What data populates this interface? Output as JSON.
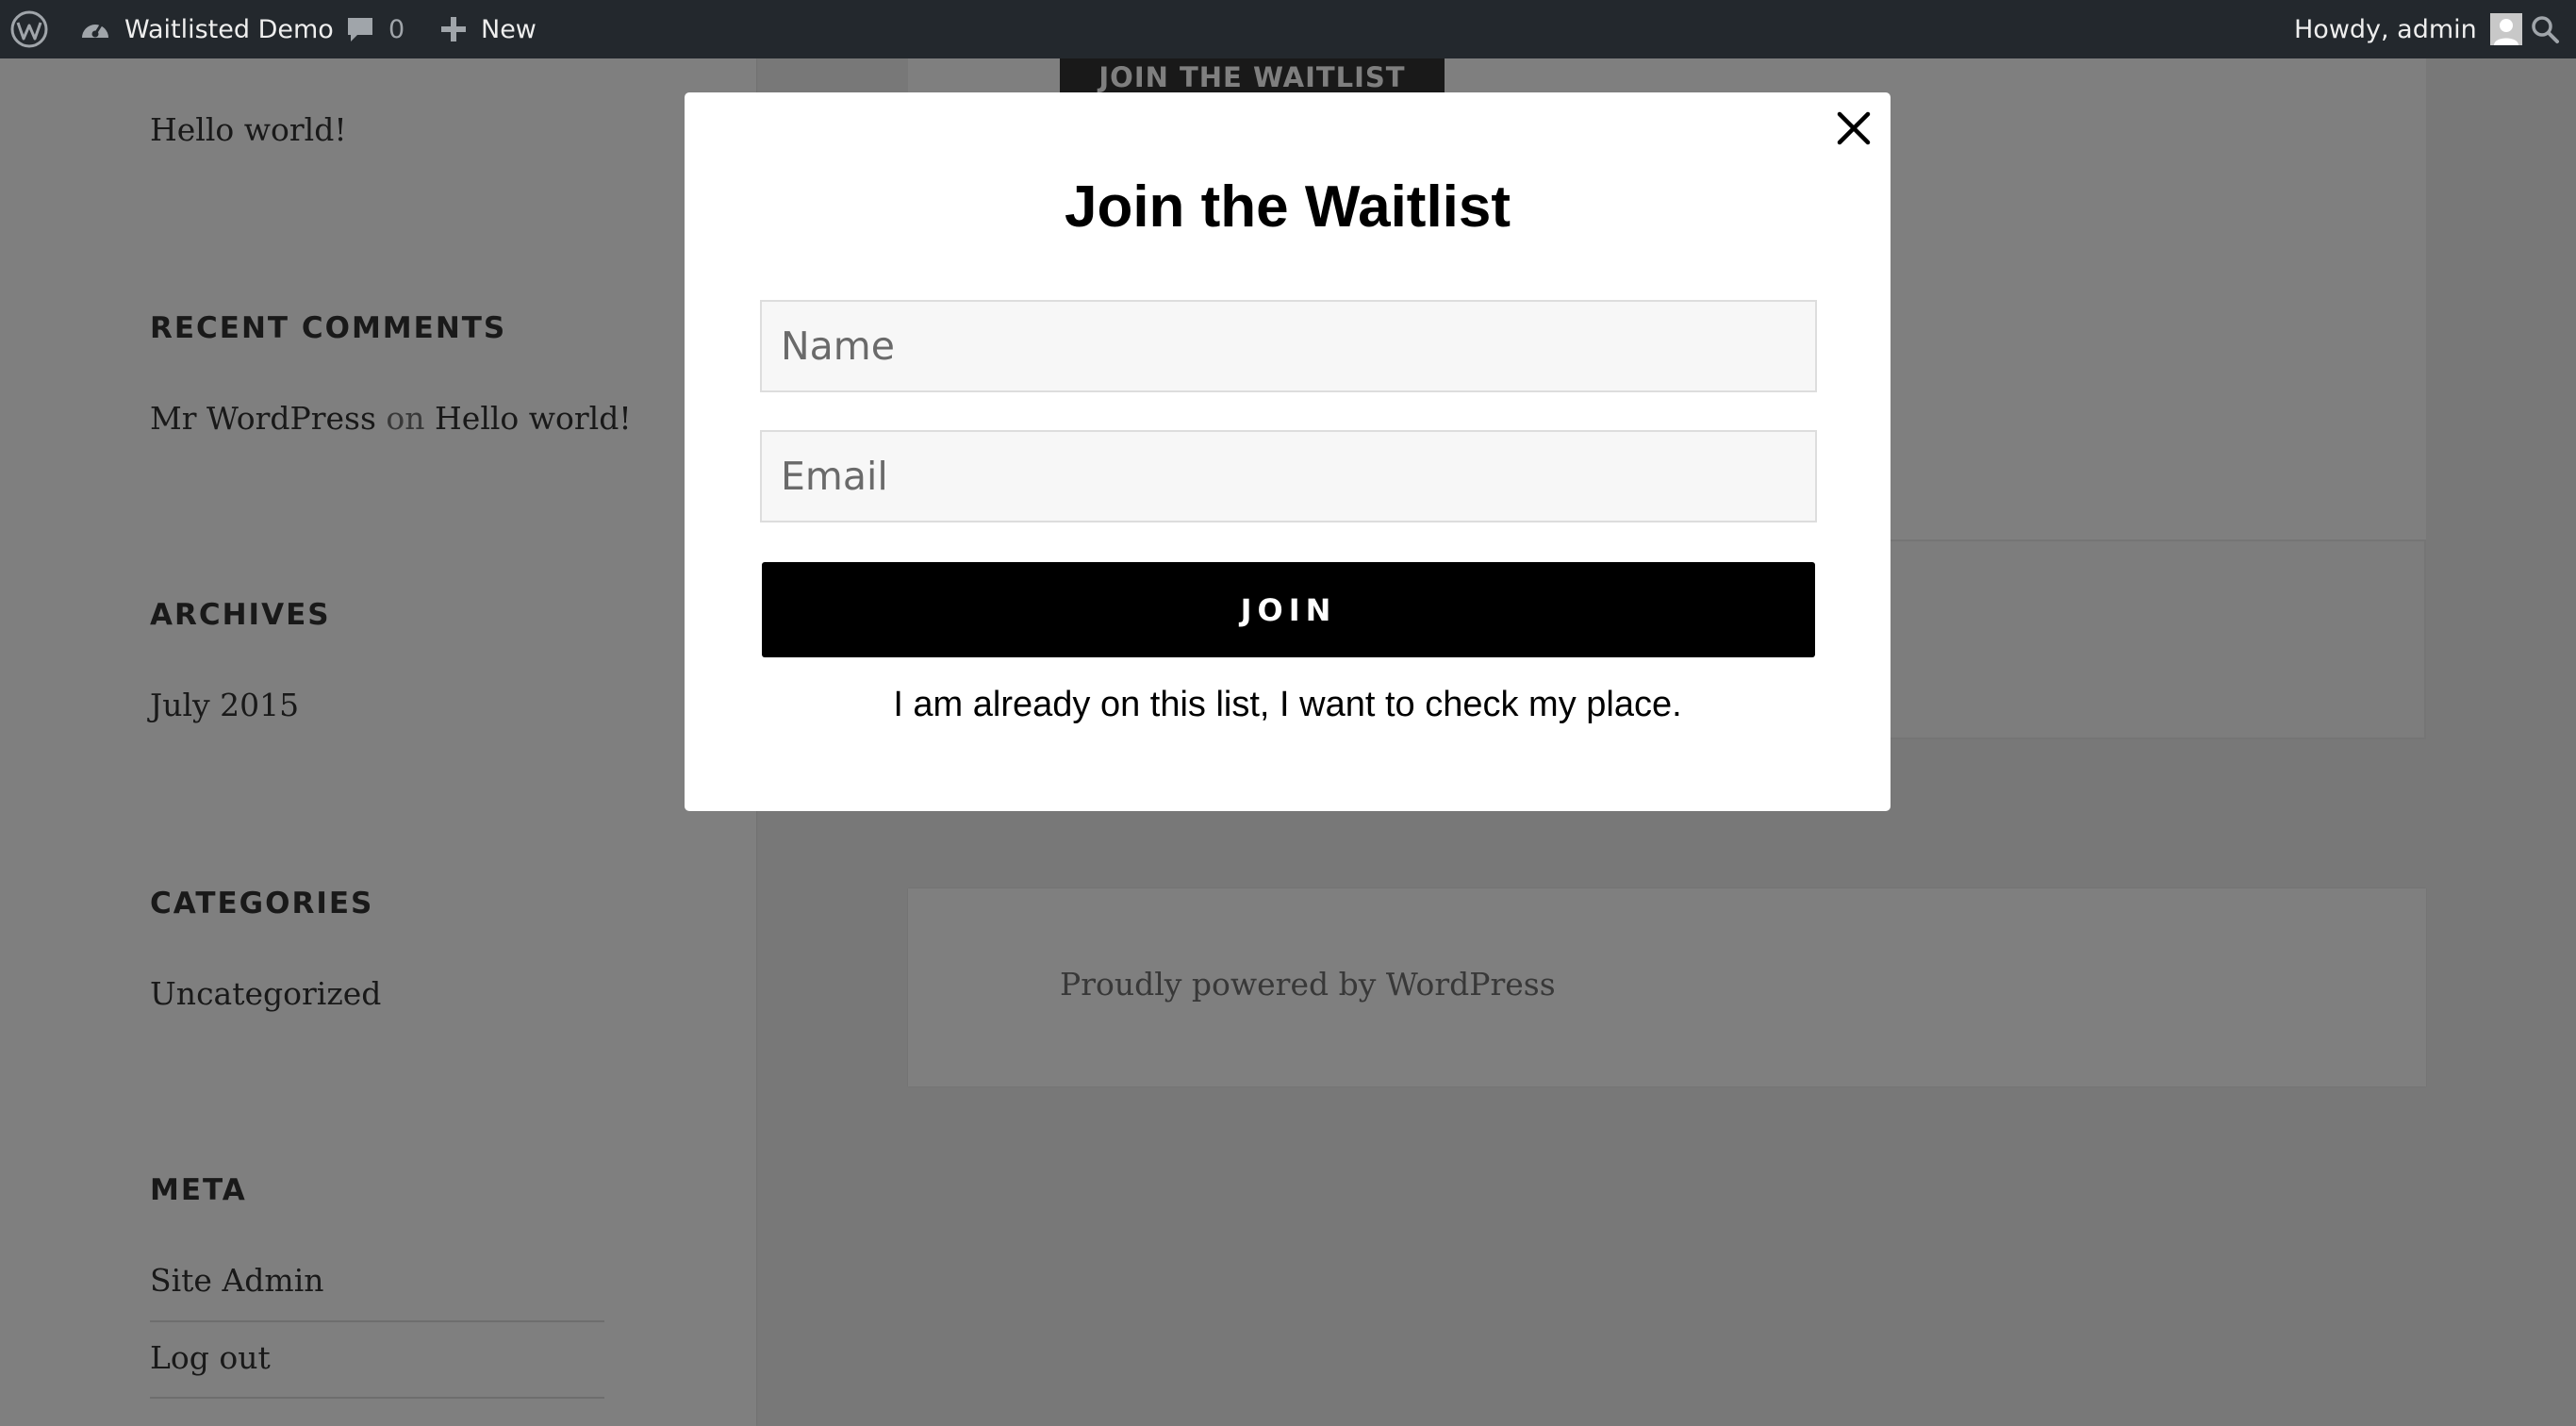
{
  "admin_bar": {
    "site_name": "Waitlisted Demo",
    "comments_count": "0",
    "new_label": "New",
    "greeting": "Howdy, admin"
  },
  "sidebar": {
    "recent_post": "Hello world!",
    "recent_comments": {
      "title": "RECENT COMMENTS",
      "author": "Mr WordPress",
      "on_word": "on",
      "post": "Hello world!"
    },
    "archives": {
      "title": "ARCHIVES",
      "items": [
        "July 2015"
      ]
    },
    "categories": {
      "title": "CATEGORIES",
      "items": [
        "Uncategorized"
      ]
    },
    "meta": {
      "title": "META",
      "items": [
        "Site Admin",
        "Log out"
      ]
    }
  },
  "content": {
    "join_button_label": "JOIN THE WAITLIST",
    "footer_text": "Proudly powered by WordPress"
  },
  "modal": {
    "title": "Join the Waitlist",
    "name_placeholder": "Name",
    "email_placeholder": "Email",
    "join_label": "JOIN",
    "check_place_link": "I am already on this list, I want to check my place."
  },
  "colors": {
    "admin_bar_bg": "#23282d",
    "overlay": "rgba(0,0,0,0.5)",
    "join_button_bg": "#000000"
  }
}
